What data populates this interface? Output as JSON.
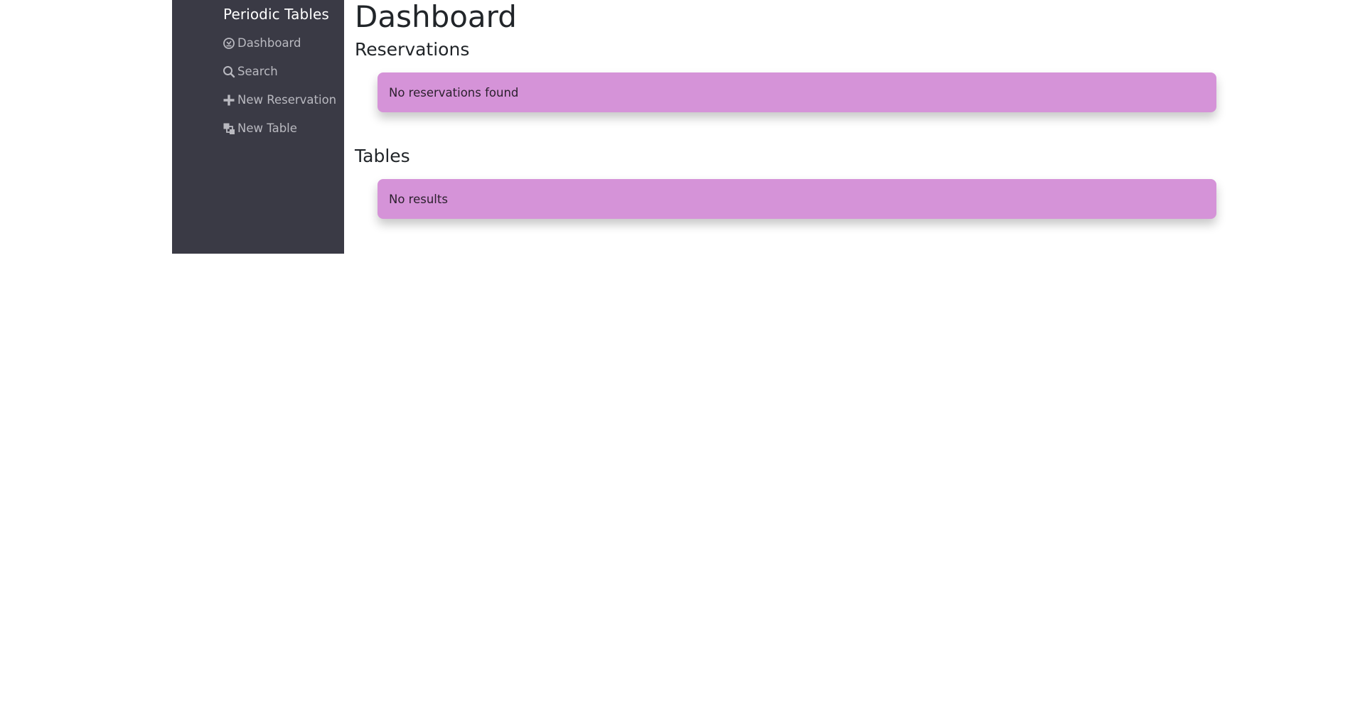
{
  "app": {
    "brand": "Periodic Tables"
  },
  "sidebar": {
    "items": [
      {
        "label": "Dashboard",
        "icon": "dashboard-icon"
      },
      {
        "label": "Search",
        "icon": "search-icon"
      },
      {
        "label": "New Reservation",
        "icon": "plus-icon"
      },
      {
        "label": "New Table",
        "icon": "layers-icon"
      }
    ]
  },
  "main": {
    "title": "Dashboard",
    "reservations": {
      "heading": "Reservations",
      "message": "No reservations found"
    },
    "tables": {
      "heading": "Tables",
      "message": "No results"
    }
  },
  "colors": {
    "sidebar_bg": "#3a3a45",
    "alert_bg": "#d593d8"
  }
}
